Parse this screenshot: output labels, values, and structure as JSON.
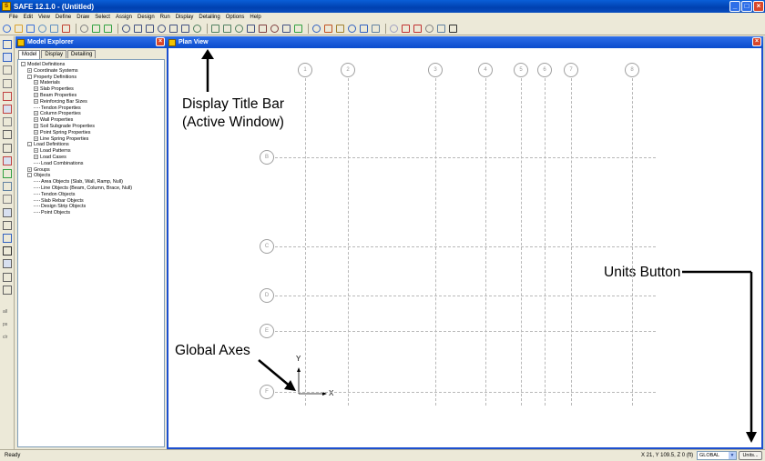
{
  "app": {
    "title": "SAFE 12.1.0 - (Untitled)",
    "logo_text": "S"
  },
  "window_buttons": [
    "_",
    "□",
    "×"
  ],
  "menubar": {
    "items": [
      "File",
      "Edit",
      "View",
      "Define",
      "Draw",
      "Select",
      "Assign",
      "Design",
      "Run",
      "Display",
      "Detailing",
      "Options",
      "Help"
    ]
  },
  "toolbar": {
    "icons": [
      "new-file-icon",
      "open-folder-icon",
      "save-icon",
      "undo-icon",
      "redo-icon",
      "pencil-icon",
      "lock-icon",
      "run-icon",
      "step-run-icon",
      "zoom-window-icon",
      "zoom-in-icon",
      "zoom-out-icon",
      "zoom-restore-icon",
      "zoom-previous-icon",
      "pan-icon",
      "3d-view-icon",
      "plan-view-icon",
      "elevation-view-icon",
      "rotate-icon",
      "set-display-options-icon",
      "move-up-icon",
      "move-down-icon",
      "shrink-icon",
      "check-icon",
      "circle-icon",
      "object-shrink-icon",
      "triangle-icon",
      "pointer-icon",
      "line-icon",
      "table-icon",
      "slab-design-icon",
      "strip-icon",
      "rebar-icon",
      "grid-icon",
      "view-icon",
      "chart-icon"
    ]
  },
  "left_toolbar": {
    "icons": [
      "select-pointer-icon",
      "pointer-reshape-icon",
      "draw-slab-icon",
      "draw-rectangle-icon",
      "draw-beam-icon",
      "draw-column-icon",
      "draw-wall-icon",
      "draw-line-icon",
      "draw-poly-icon",
      "draw-wall-grid-icon",
      "quick-draw-icon",
      "draw-strip-icon",
      "draw-point-load-icon",
      "draw-tendon-icon",
      "draw-rebar-icon",
      "draw-design-strip-icon",
      "all-select-icon",
      "prev-select-icon",
      "clear-select-icon",
      "snap-icon"
    ],
    "labels": [
      "all",
      "ps",
      "clr"
    ]
  },
  "model_explorer": {
    "title": "Model Explorer",
    "tabs": [
      "Model",
      "Display",
      "Detailing"
    ],
    "tree": [
      {
        "label": "Model Definitions",
        "depth": 0,
        "toggle": "-",
        "highlight": true
      },
      {
        "label": "Coordinate Systems",
        "depth": 1,
        "toggle": "+"
      },
      {
        "label": "Property Definitions",
        "depth": 1,
        "toggle": "-"
      },
      {
        "label": "Materials",
        "depth": 2,
        "toggle": "+"
      },
      {
        "label": "Slab Properties",
        "depth": 2,
        "toggle": "+"
      },
      {
        "label": "Beam Properties",
        "depth": 2,
        "toggle": "+"
      },
      {
        "label": "Reinforcing Bar Sizes",
        "depth": 2,
        "toggle": "+"
      },
      {
        "label": "Tendon Properties",
        "depth": 2,
        "toggle": ""
      },
      {
        "label": "Column Properties",
        "depth": 2,
        "toggle": "+"
      },
      {
        "label": "Wall Properties",
        "depth": 2,
        "toggle": "+"
      },
      {
        "label": "Soil Subgrade Properties",
        "depth": 2,
        "toggle": "+"
      },
      {
        "label": "Point Spring Properties",
        "depth": 2,
        "toggle": "+"
      },
      {
        "label": "Line Spring Properties",
        "depth": 2,
        "toggle": "+"
      },
      {
        "label": "Load Definitions",
        "depth": 1,
        "toggle": "-"
      },
      {
        "label": "Load Patterns",
        "depth": 2,
        "toggle": "+"
      },
      {
        "label": "Load Cases",
        "depth": 2,
        "toggle": "+"
      },
      {
        "label": "Load Combinations",
        "depth": 2,
        "toggle": ""
      },
      {
        "label": "Groups",
        "depth": 1,
        "toggle": "+"
      },
      {
        "label": "Objects",
        "depth": 1,
        "toggle": "-"
      },
      {
        "label": "Area Objects (Slab, Wall, Ramp, Null)",
        "depth": 2,
        "toggle": ""
      },
      {
        "label": "Line Objects (Beam, Column, Brace, Null)",
        "depth": 2,
        "toggle": ""
      },
      {
        "label": "Tendon Objects",
        "depth": 2,
        "toggle": ""
      },
      {
        "label": "Slab Rebar Objects",
        "depth": 2,
        "toggle": ""
      },
      {
        "label": "Design Strip Objects",
        "depth": 2,
        "toggle": ""
      },
      {
        "label": "Point Objects",
        "depth": 2,
        "toggle": ""
      }
    ]
  },
  "plan_view": {
    "title": "Plan View",
    "grid_x": [
      "1",
      "2",
      "3",
      "4",
      "5",
      "6",
      "7",
      "8"
    ],
    "grid_y": [
      "B",
      "C",
      "D",
      "E",
      "F"
    ],
    "axis_x_label": "X",
    "axis_y_label": "Y"
  },
  "annotations": {
    "title_bar_line1": "Display Title Bar",
    "title_bar_line2": "(Active Window)",
    "units_button": "Units Button",
    "global_axes": "Global Axes"
  },
  "statusbar": {
    "status": "Ready",
    "coordinates": "X 21, Y 109.5, Z 0 (ft)",
    "coord_system": "GLOBAL",
    "units_label": "Units..."
  },
  "colors": {
    "title_bar": "#0a4fc0",
    "panel_title": "#1c4fcf",
    "chrome": "#ECE9D8",
    "grid_line": "#b8b8b8"
  }
}
